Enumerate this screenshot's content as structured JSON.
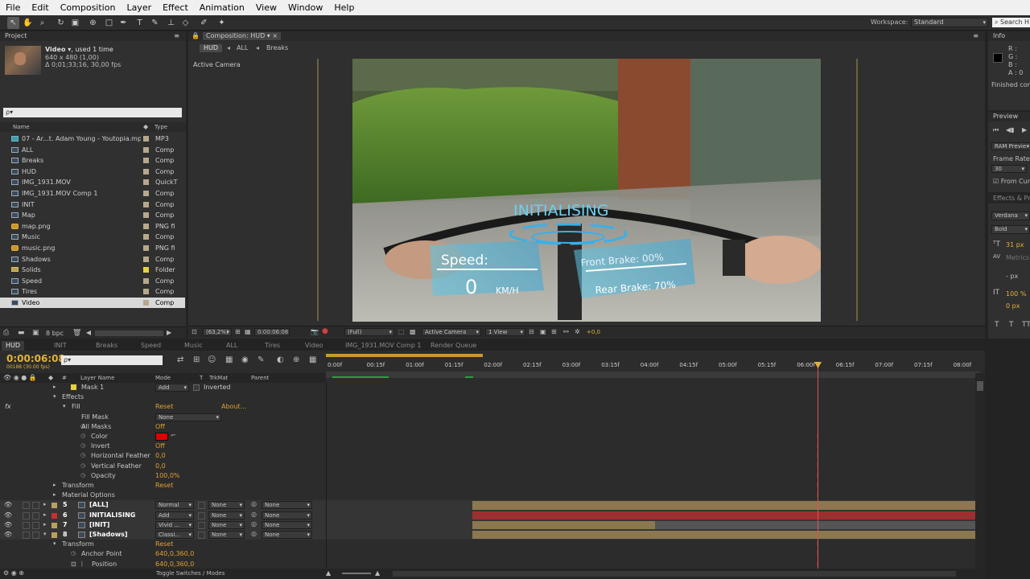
{
  "menu": [
    "File",
    "Edit",
    "Composition",
    "Layer",
    "Effect",
    "Animation",
    "View",
    "Window",
    "Help"
  ],
  "workspace": {
    "label": "Workspace:",
    "value": "Standard",
    "search_placeholder": "Search H"
  },
  "project": {
    "panel_title": "Project",
    "footage_name": "Video ▾",
    "used": ", used 1 time",
    "dims": "640 x 480 (1,00)",
    "duration": "Δ 0;01;33;16, 30,00 fps",
    "search_placeholder": "ρ▾",
    "col_name": "Name",
    "col_type": "Type",
    "items": [
      {
        "name": "07 - Ar...t. Adam Young - Youtopia.mp3",
        "type": "MP3",
        "icon": "audio",
        "color": "#b8a88a"
      },
      {
        "name": "ALL",
        "type": "Comp",
        "icon": "comp",
        "color": "#b8a88a"
      },
      {
        "name": "Breaks",
        "type": "Comp",
        "icon": "comp",
        "color": "#b8a88a"
      },
      {
        "name": "HUD",
        "type": "Comp",
        "icon": "comp",
        "color": "#b8a88a"
      },
      {
        "name": "IMG_1931.MOV",
        "type": "QuickT",
        "icon": "comp",
        "color": "#b8a88a"
      },
      {
        "name": "IMG_1931.MOV Comp 1",
        "type": "Comp",
        "icon": "comp",
        "color": "#b8a88a"
      },
      {
        "name": "INIT",
        "type": "Comp",
        "icon": "comp",
        "color": "#b8a88a"
      },
      {
        "name": "Map",
        "type": "Comp",
        "icon": "comp",
        "color": "#b8a88a"
      },
      {
        "name": "map.png",
        "type": "PNG fi",
        "icon": "image",
        "color": "#b8a88a"
      },
      {
        "name": "Music",
        "type": "Comp",
        "icon": "comp",
        "color": "#b8a88a"
      },
      {
        "name": "music.png",
        "type": "PNG fi",
        "icon": "image",
        "color": "#b8a88a"
      },
      {
        "name": "Shadows",
        "type": "Comp",
        "icon": "comp",
        "color": "#b8a88a"
      },
      {
        "name": "Solids",
        "type": "Folder",
        "icon": "folder",
        "color": "#e6d33c"
      },
      {
        "name": "Speed",
        "type": "Comp",
        "icon": "comp",
        "color": "#b8a88a"
      },
      {
        "name": "Tires",
        "type": "Comp",
        "icon": "comp",
        "color": "#b8a88a"
      },
      {
        "name": "Video",
        "type": "Comp",
        "icon": "comp",
        "color": "#b8a88a",
        "selected": true
      }
    ],
    "bpc": "8 bpc"
  },
  "composition": {
    "panel_title": "Composition: HUD",
    "breadcrumbs": [
      "HUD",
      "ALL",
      "Breaks"
    ],
    "active_camera_label": "Active Camera",
    "zoom": "(63,2%)",
    "timecode": "0:00:06:08",
    "resolution": "(Full)",
    "camera": "Active Camera",
    "views": "1 View",
    "exposure": "+0,0"
  },
  "hud_overlay": {
    "initialising": "INITIALISING",
    "speed_label": "Speed:",
    "speed_value": "0",
    "speed_unit": "KM/H",
    "front_brake": "Front  Brake: 00%",
    "rear_brake": "Rear  Brake: 70%"
  },
  "info": {
    "panel_title": "Info",
    "r": "R :",
    "g": "G :",
    "b": "B :",
    "a": "A : 0",
    "status": "Finished com"
  },
  "preview": {
    "panel_title": "Preview",
    "ram_preview": "RAM Previe",
    "frame_rate_label": "Frame Rate",
    "frame_rate": "30",
    "from_current": "From Curr"
  },
  "effects_presets": {
    "panel_title": "Effects & Pr"
  },
  "character": {
    "font": "Verdana",
    "style": "Bold",
    "size": "31 px",
    "metrics": "Metrics",
    "leading": "- px",
    "scale": "100 %",
    "baseline": "0 px"
  },
  "paragraph": {
    "panel_title": "Paragraph",
    "indent1": "0 px",
    "indent2": "0 px"
  },
  "timeline": {
    "tabs": [
      "HUD",
      "INIT",
      "Breaks",
      "Speed",
      "Music",
      "ALL",
      "Tires",
      "Video",
      "IMG_1931.MOV Comp 1",
      "Render Queue"
    ],
    "timecode": "0:00:06:08",
    "fps_info": "00188 (30.00 fps)",
    "search_placeholder": "ρ▾",
    "col_hash": "#",
    "col_layer_name": "Layer Name",
    "col_mode": "Mode",
    "col_t": "T",
    "col_trkmat": "TrkMat",
    "col_parent": "Parent",
    "ruler": [
      "0:00f",
      "00:15f",
      "01:00f",
      "01:15f",
      "02:00f",
      "02:15f",
      "03:00f",
      "03:15f",
      "04:00f",
      "04:15f",
      "05:00f",
      "05:15f",
      "06:00f",
      "06:15f",
      "07:00f",
      "07:15f",
      "08:00f"
    ],
    "mask_row": {
      "name": "Mask 1",
      "mode": "Add",
      "inverted": "Inverted"
    },
    "effects_label": "Effects",
    "fx_label": "fx",
    "fill": {
      "label": "Fill",
      "reset": "Reset",
      "about": "About..."
    },
    "properties": [
      {
        "label": "Fill Mask",
        "value": "None",
        "type": "dropdown"
      },
      {
        "label": "All Masks",
        "value": "Off",
        "type": "value"
      },
      {
        "label": "Color",
        "value": "",
        "type": "color",
        "color": "#e00000"
      },
      {
        "label": "Invert",
        "value": "Off",
        "type": "value"
      },
      {
        "label": "Horizontal Feather",
        "value": "0,0",
        "type": "value"
      },
      {
        "label": "Vertical Feather",
        "value": "0,0",
        "type": "value"
      },
      {
        "label": "Opacity",
        "value": "100,0%",
        "type": "value"
      }
    ],
    "transform_label": "Transform",
    "transform_reset": "Reset",
    "material_options": "Material Options",
    "layers": [
      {
        "num": "5",
        "name": "[ALL]",
        "mode": "Normal",
        "trkmat": "None",
        "parent": "None",
        "color": "#b8a060"
      },
      {
        "num": "6",
        "name": "INITIALISING",
        "mode": "Add",
        "trkmat": "None",
        "parent": "None",
        "color": "#c83030"
      },
      {
        "num": "7",
        "name": "[INIT]",
        "mode": "Vivid ...",
        "trkmat": "None",
        "parent": "None",
        "color": "#b8a060"
      },
      {
        "num": "8",
        "name": "[Shadows]",
        "mode": "Classi...",
        "trkmat": "None",
        "parent": "None",
        "color": "#b8a060"
      }
    ],
    "transform2": {
      "label": "Transform",
      "reset": "Reset"
    },
    "anchor_point": {
      "label": "Anchor Point",
      "value": "640,0,360,0"
    },
    "position": {
      "label": "Position",
      "value": "640,0,360,0"
    },
    "toggle": "Toggle Switches / Modes"
  },
  "colors": {
    "accent": "#e2b23a",
    "playhead": "#e05050",
    "red_bar": "#9c3030",
    "tan_bar": "#8c7850"
  }
}
